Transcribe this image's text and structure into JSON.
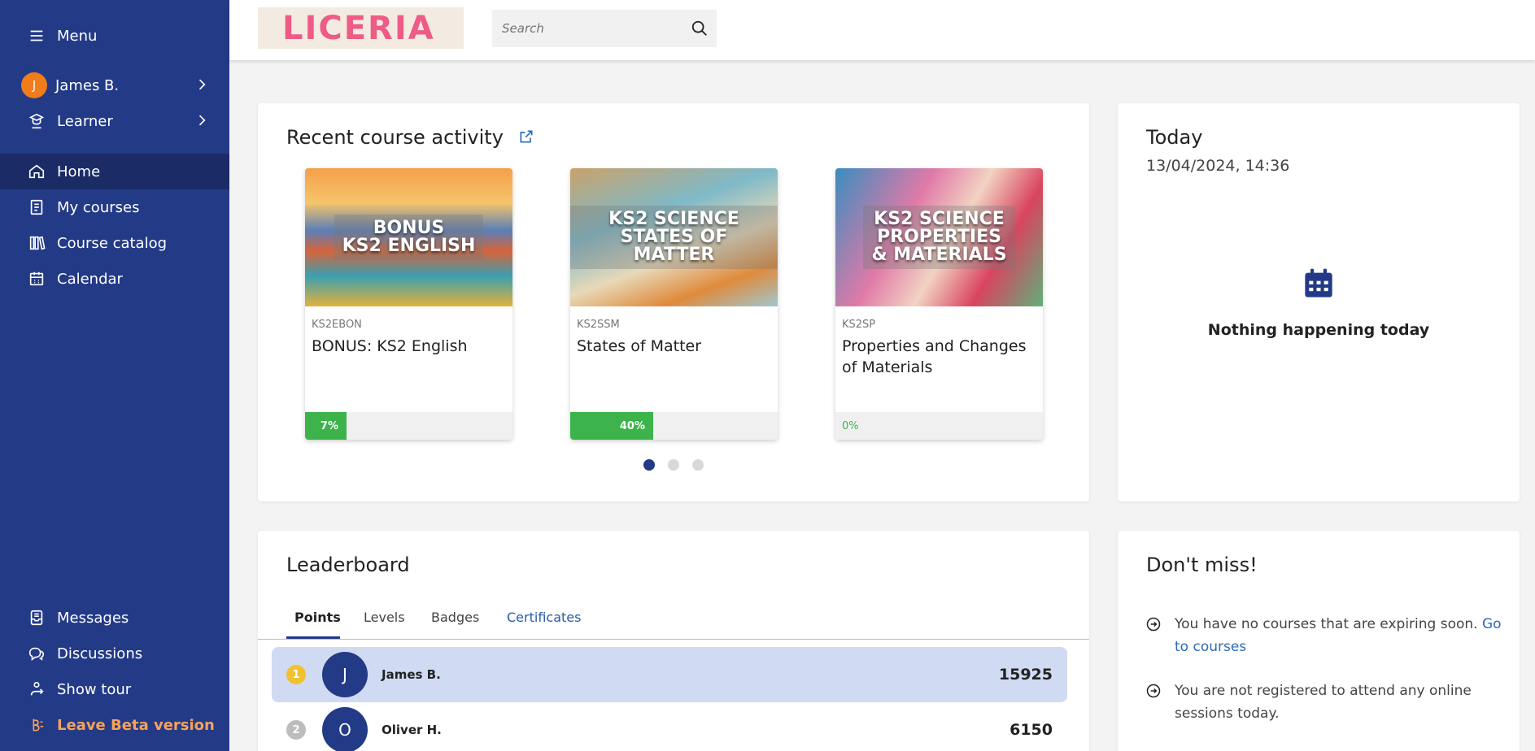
{
  "sidebar": {
    "menu_label": "Menu",
    "user": {
      "initial": "J",
      "name": "James B."
    },
    "role": "Learner",
    "nav": [
      {
        "label": "Home",
        "icon": "home-icon"
      },
      {
        "label": "My courses",
        "icon": "book-icon"
      },
      {
        "label": "Course catalog",
        "icon": "library-icon"
      },
      {
        "label": "Calendar",
        "icon": "calendar-icon"
      }
    ],
    "bottom": [
      {
        "label": "Messages",
        "icon": "inbox-icon"
      },
      {
        "label": "Discussions",
        "icon": "chat-icon"
      },
      {
        "label": "Show tour",
        "icon": "tour-icon"
      },
      {
        "label": "Leave Beta version",
        "icon": "beta-icon"
      }
    ]
  },
  "topbar": {
    "logo_text": "LICERIA",
    "search_placeholder": "Search"
  },
  "recent": {
    "title": "Recent course activity",
    "courses": [
      {
        "code": "KS2EBON",
        "name": "BONUS: KS2 English",
        "image_text": "BONUS\nKS2 ENGLISH",
        "progress": 7,
        "progress_label": "7%"
      },
      {
        "code": "KS2SSM",
        "name": "States of Matter",
        "image_text": "KS2 SCIENCE\nSTATES OF MATTER",
        "progress": 40,
        "progress_label": "40%"
      },
      {
        "code": "KS2SP",
        "name": "Properties and Changes of Materials",
        "image_text": "KS2 SCIENCE\nPROPERTIES\n& MATERIALS",
        "progress": 0,
        "progress_label": "0%"
      }
    ]
  },
  "today": {
    "title": "Today",
    "datetime": "13/04/2024, 14:36",
    "empty_text": "Nothing happening today"
  },
  "leaderboard": {
    "title": "Leaderboard",
    "tabs": [
      "Points",
      "Levels",
      "Badges",
      "Certificates"
    ],
    "rows": [
      {
        "rank": "1",
        "initial": "J",
        "name": "James B.",
        "points": "15925"
      },
      {
        "rank": "2",
        "initial": "O",
        "name": "Oliver H.",
        "points": "6150"
      }
    ]
  },
  "dont_miss": {
    "title": "Don't miss!",
    "item1_text": "You have no courses that are expiring soon. ",
    "item1_link": "Go to courses",
    "item2_text": "You are not registered to attend any online sessions today."
  },
  "colors": {
    "sidebar": "#233a87",
    "accent": "#233a87",
    "progress": "#3cb44b",
    "beta": "#f5a25d"
  }
}
